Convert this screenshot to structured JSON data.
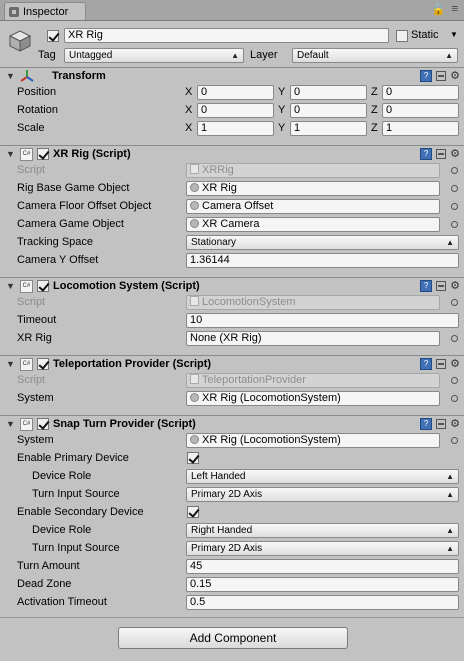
{
  "tab": {
    "title": "Inspector"
  },
  "gameobject": {
    "name": "XR Rig",
    "static_label": "Static",
    "tag_label": "Tag",
    "tag_value": "Untagged",
    "layer_label": "Layer",
    "layer_value": "Default"
  },
  "transform": {
    "title": "Transform",
    "rows": [
      {
        "label": "Position",
        "x": "0",
        "y": "0",
        "z": "0"
      },
      {
        "label": "Rotation",
        "x": "0",
        "y": "0",
        "z": "0"
      },
      {
        "label": "Scale",
        "x": "1",
        "y": "1",
        "z": "1"
      }
    ],
    "axis": {
      "x": "X",
      "y": "Y",
      "z": "Z"
    }
  },
  "xr_rig": {
    "title": "XR Rig (Script)",
    "script_label": "Script",
    "script_value": "XRRig",
    "rig_base_label": "Rig Base Game Object",
    "rig_base_value": "XR Rig",
    "camera_floor_label": "Camera Floor Offset Object",
    "camera_floor_value": "Camera Offset",
    "camera_go_label": "Camera Game Object",
    "camera_go_value": "XR Camera",
    "tracking_label": "Tracking Space",
    "tracking_value": "Stationary",
    "camera_y_label": "Camera Y Offset",
    "camera_y_value": "1.36144"
  },
  "locomotion": {
    "title": "Locomotion System (Script)",
    "script_label": "Script",
    "script_value": "LocomotionSystem",
    "timeout_label": "Timeout",
    "timeout_value": "10",
    "xrrig_label": "XR Rig",
    "xrrig_value": "None (XR Rig)"
  },
  "teleport": {
    "title": "Teleportation Provider (Script)",
    "script_label": "Script",
    "script_value": "TeleportationProvider",
    "system_label": "System",
    "system_value": "XR Rig (LocomotionSystem)"
  },
  "snap": {
    "title": "Snap Turn Provider (Script)",
    "system_label": "System",
    "system_value": "XR Rig (LocomotionSystem)",
    "enable_primary_label": "Enable Primary Device",
    "device_role_label": "Device Role",
    "primary_role_value": "Left Handed",
    "turn_input_label": "Turn Input Source",
    "primary_input_value": "Primary 2D Axis",
    "enable_secondary_label": "Enable Secondary Device",
    "secondary_role_value": "Right Handed",
    "secondary_input_value": "Primary 2D Axis",
    "turn_amount_label": "Turn Amount",
    "turn_amount_value": "45",
    "dead_zone_label": "Dead Zone",
    "dead_zone_value": "0.15",
    "activation_label": "Activation Timeout",
    "activation_value": "0.5"
  },
  "add_component": "Add Component"
}
